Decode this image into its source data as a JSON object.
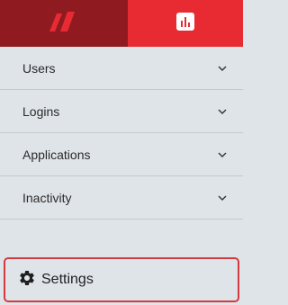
{
  "header": {
    "logo_icon": "brand-logo-icon",
    "active_icon": "bar-chart-icon",
    "colors": {
      "logo_bg": "#8f1b20",
      "active_bg": "#e82b33"
    }
  },
  "nav": {
    "items": [
      {
        "label": "Users",
        "icon": "chevron-down-icon"
      },
      {
        "label": "Logins",
        "icon": "chevron-down-icon"
      },
      {
        "label": "Applications",
        "icon": "chevron-down-icon"
      },
      {
        "label": "Inactivity",
        "icon": "chevron-down-icon"
      }
    ]
  },
  "settings": {
    "label": "Settings",
    "icon": "gear-icon",
    "highlight_color": "#d33a40"
  }
}
